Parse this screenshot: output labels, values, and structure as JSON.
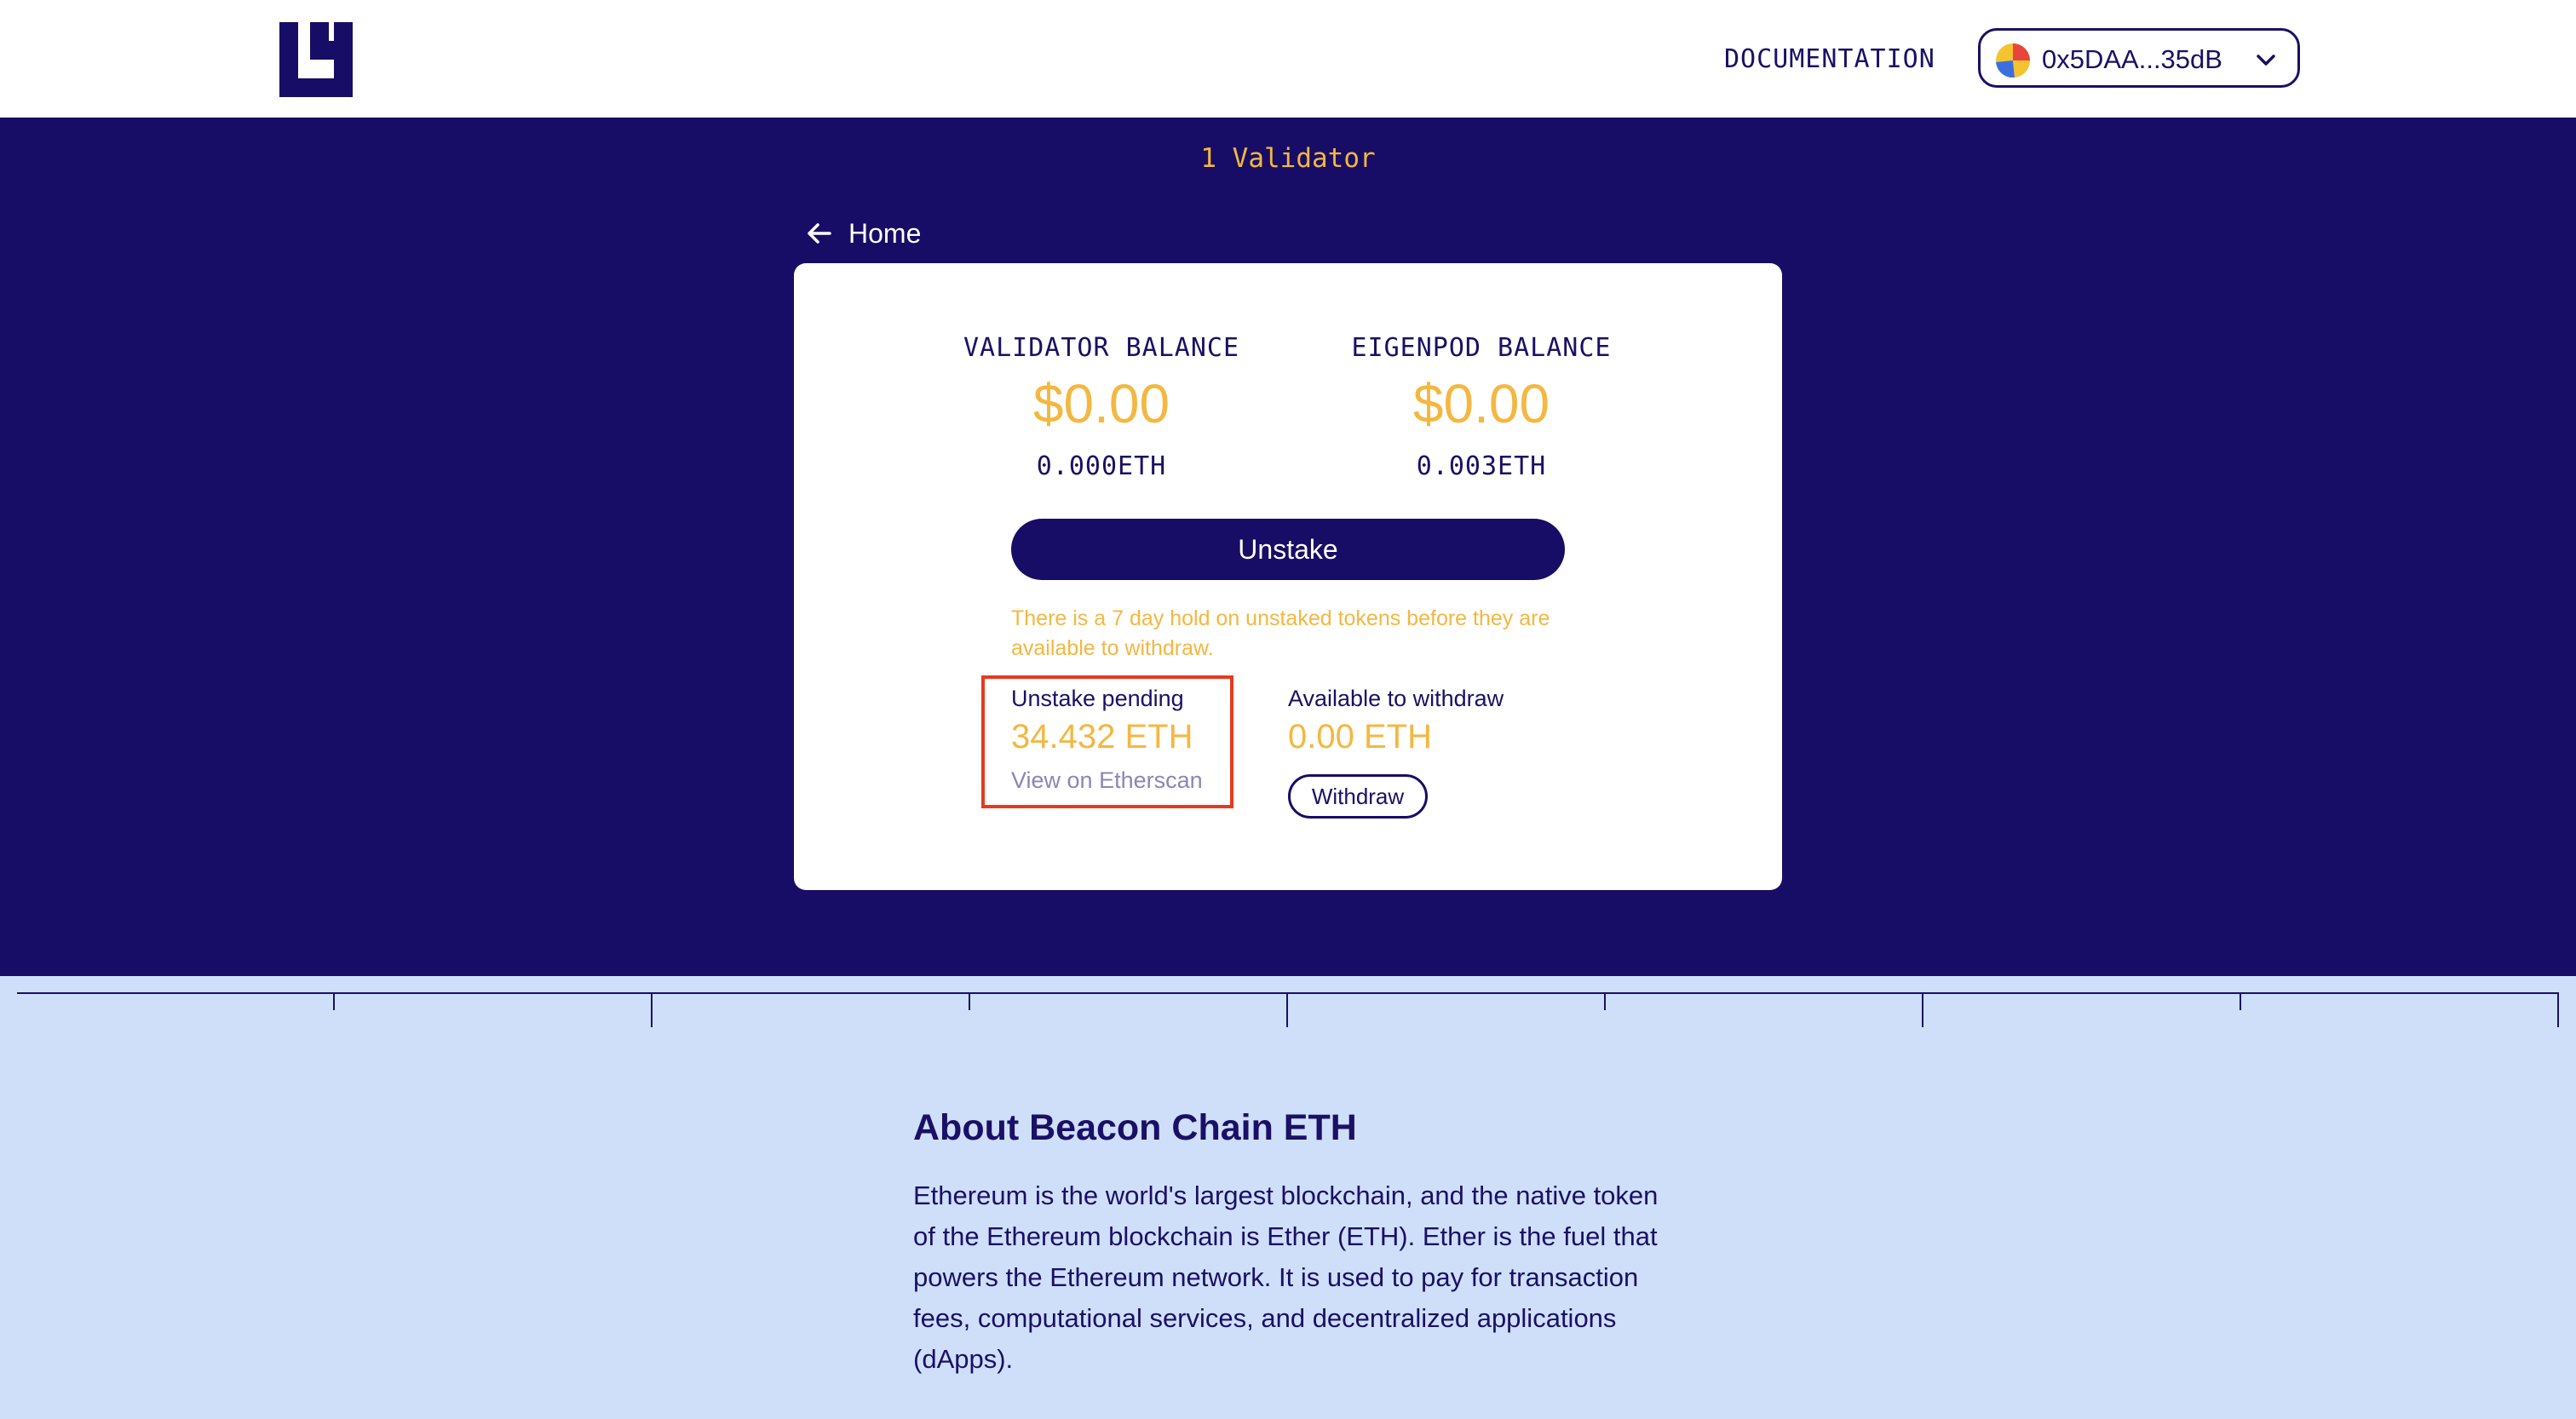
{
  "header": {
    "documentation_label": "DOCUMENTATION",
    "wallet_address": "0x5DAA...35dB",
    "logo_icon": "eigenlayer-logo",
    "avatar_icon": "wallet-avatar-icon",
    "chevron_icon": "chevron-down-icon"
  },
  "hero": {
    "validator_count": "1 Validator",
    "back_label": "Home",
    "validator_balance": {
      "label": "VALIDATOR BALANCE",
      "usd": "$0.00",
      "eth": "0.000ETH"
    },
    "eigenpod_balance": {
      "label": "EIGENPOD BALANCE",
      "usd": "$0.00",
      "eth": "0.003ETH"
    },
    "unstake_label": "Unstake",
    "hold_note": "There is a 7 day hold on unstaked tokens before they are available to withdraw.",
    "pending": {
      "title": "Unstake pending",
      "amount": "34.432 ETH",
      "link": "View on Etherscan"
    },
    "available": {
      "title": "Available to withdraw",
      "amount": "0.00 ETH",
      "button": "Withdraw"
    }
  },
  "about": {
    "title": "About Beacon Chain ETH",
    "body": "Ethereum is the world's largest blockchain, and the native token of the Ethereum blockchain is Ether (ETH). Ether is the fuel that powers the Ethereum network. It is used to pay for transaction fees, computational services, and decentralized applications (dApps)."
  },
  "colors": {
    "navy": "#180d66",
    "gold": "#f4b740",
    "light_blue": "#cfdffa",
    "highlight_red": "#e63a1e"
  }
}
